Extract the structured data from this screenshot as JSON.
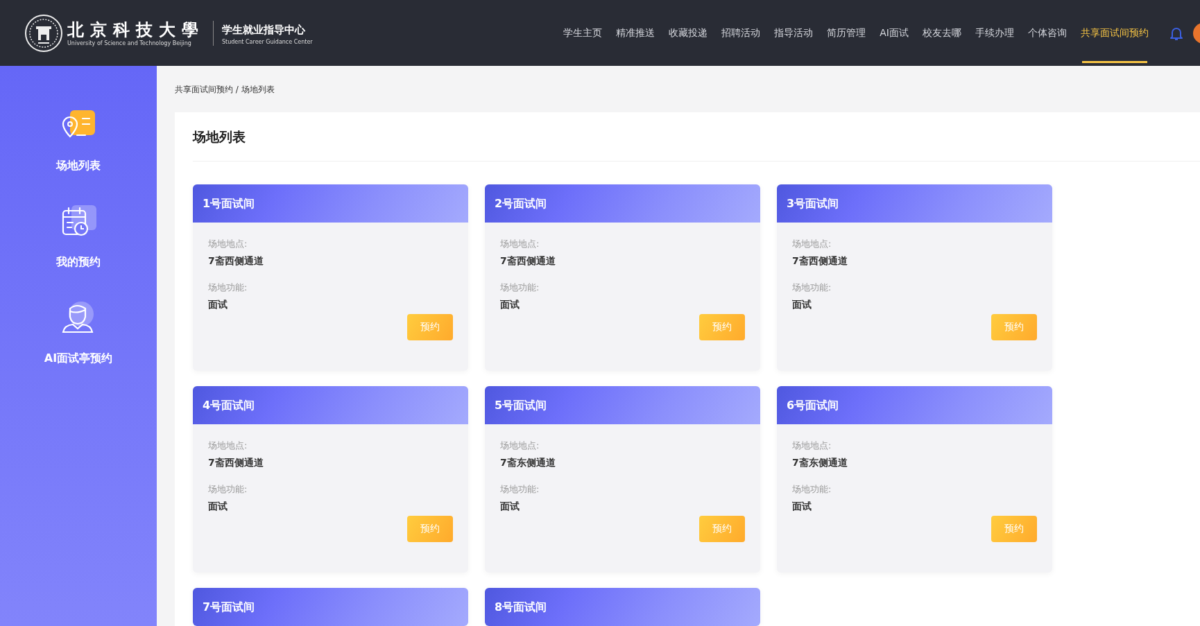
{
  "header": {
    "logo": {
      "name": "北京科技大學",
      "name_en": "University of Science and Technology Beijing",
      "unit": "学生就业指导中心",
      "unit_en": "Student Career Guidance Center"
    },
    "nav": [
      {
        "label": "学生主页",
        "selected": false
      },
      {
        "label": "精准推送",
        "selected": false
      },
      {
        "label": "收藏投递",
        "selected": false
      },
      {
        "label": "招聘活动",
        "selected": false
      },
      {
        "label": "指导活动",
        "selected": false
      },
      {
        "label": "简历管理",
        "selected": false
      },
      {
        "label": "AI面试",
        "selected": false
      },
      {
        "label": "校友去哪",
        "selected": false
      },
      {
        "label": "手续办理",
        "selected": false
      },
      {
        "label": "个体咨询",
        "selected": false
      },
      {
        "label": "共享面试间预约",
        "selected": true
      }
    ]
  },
  "sidebar": {
    "items": [
      {
        "label": "场地列表",
        "kind": "venues",
        "selected": true
      },
      {
        "label": "我的预约",
        "kind": "bookings",
        "selected": false
      },
      {
        "label": "AI面试亭预约",
        "kind": "ai",
        "selected": false
      }
    ]
  },
  "breadcrumb": "共享面试间预约 / 场地列表",
  "panel": {
    "title": "场地列表",
    "rooms": [
      {
        "name": "1号面试间",
        "location_label": "场地地点:",
        "location": "7斋西侧通道",
        "function_label": "场地功能:",
        "function": "面试",
        "button": "预约"
      },
      {
        "name": "2号面试间",
        "location_label": "场地地点:",
        "location": "7斋西侧通道",
        "function_label": "场地功能:",
        "function": "面试",
        "button": "预约"
      },
      {
        "name": "3号面试间",
        "location_label": "场地地点:",
        "location": "7斋西侧通道",
        "function_label": "场地功能:",
        "function": "面试",
        "button": "预约"
      },
      {
        "name": "4号面试间",
        "location_label": "场地地点:",
        "location": "7斋西侧通道",
        "function_label": "场地功能:",
        "function": "面试",
        "button": "预约"
      },
      {
        "name": "5号面试间",
        "location_label": "场地地点:",
        "location": "7斋东侧通道",
        "function_label": "场地功能:",
        "function": "面试",
        "button": "预约"
      },
      {
        "name": "6号面试间",
        "location_label": "场地地点:",
        "location": "7斋东侧通道",
        "function_label": "场地功能:",
        "function": "面试",
        "button": "预约"
      },
      {
        "name": "7号面试间"
      },
      {
        "name": "8号面试间"
      }
    ]
  }
}
